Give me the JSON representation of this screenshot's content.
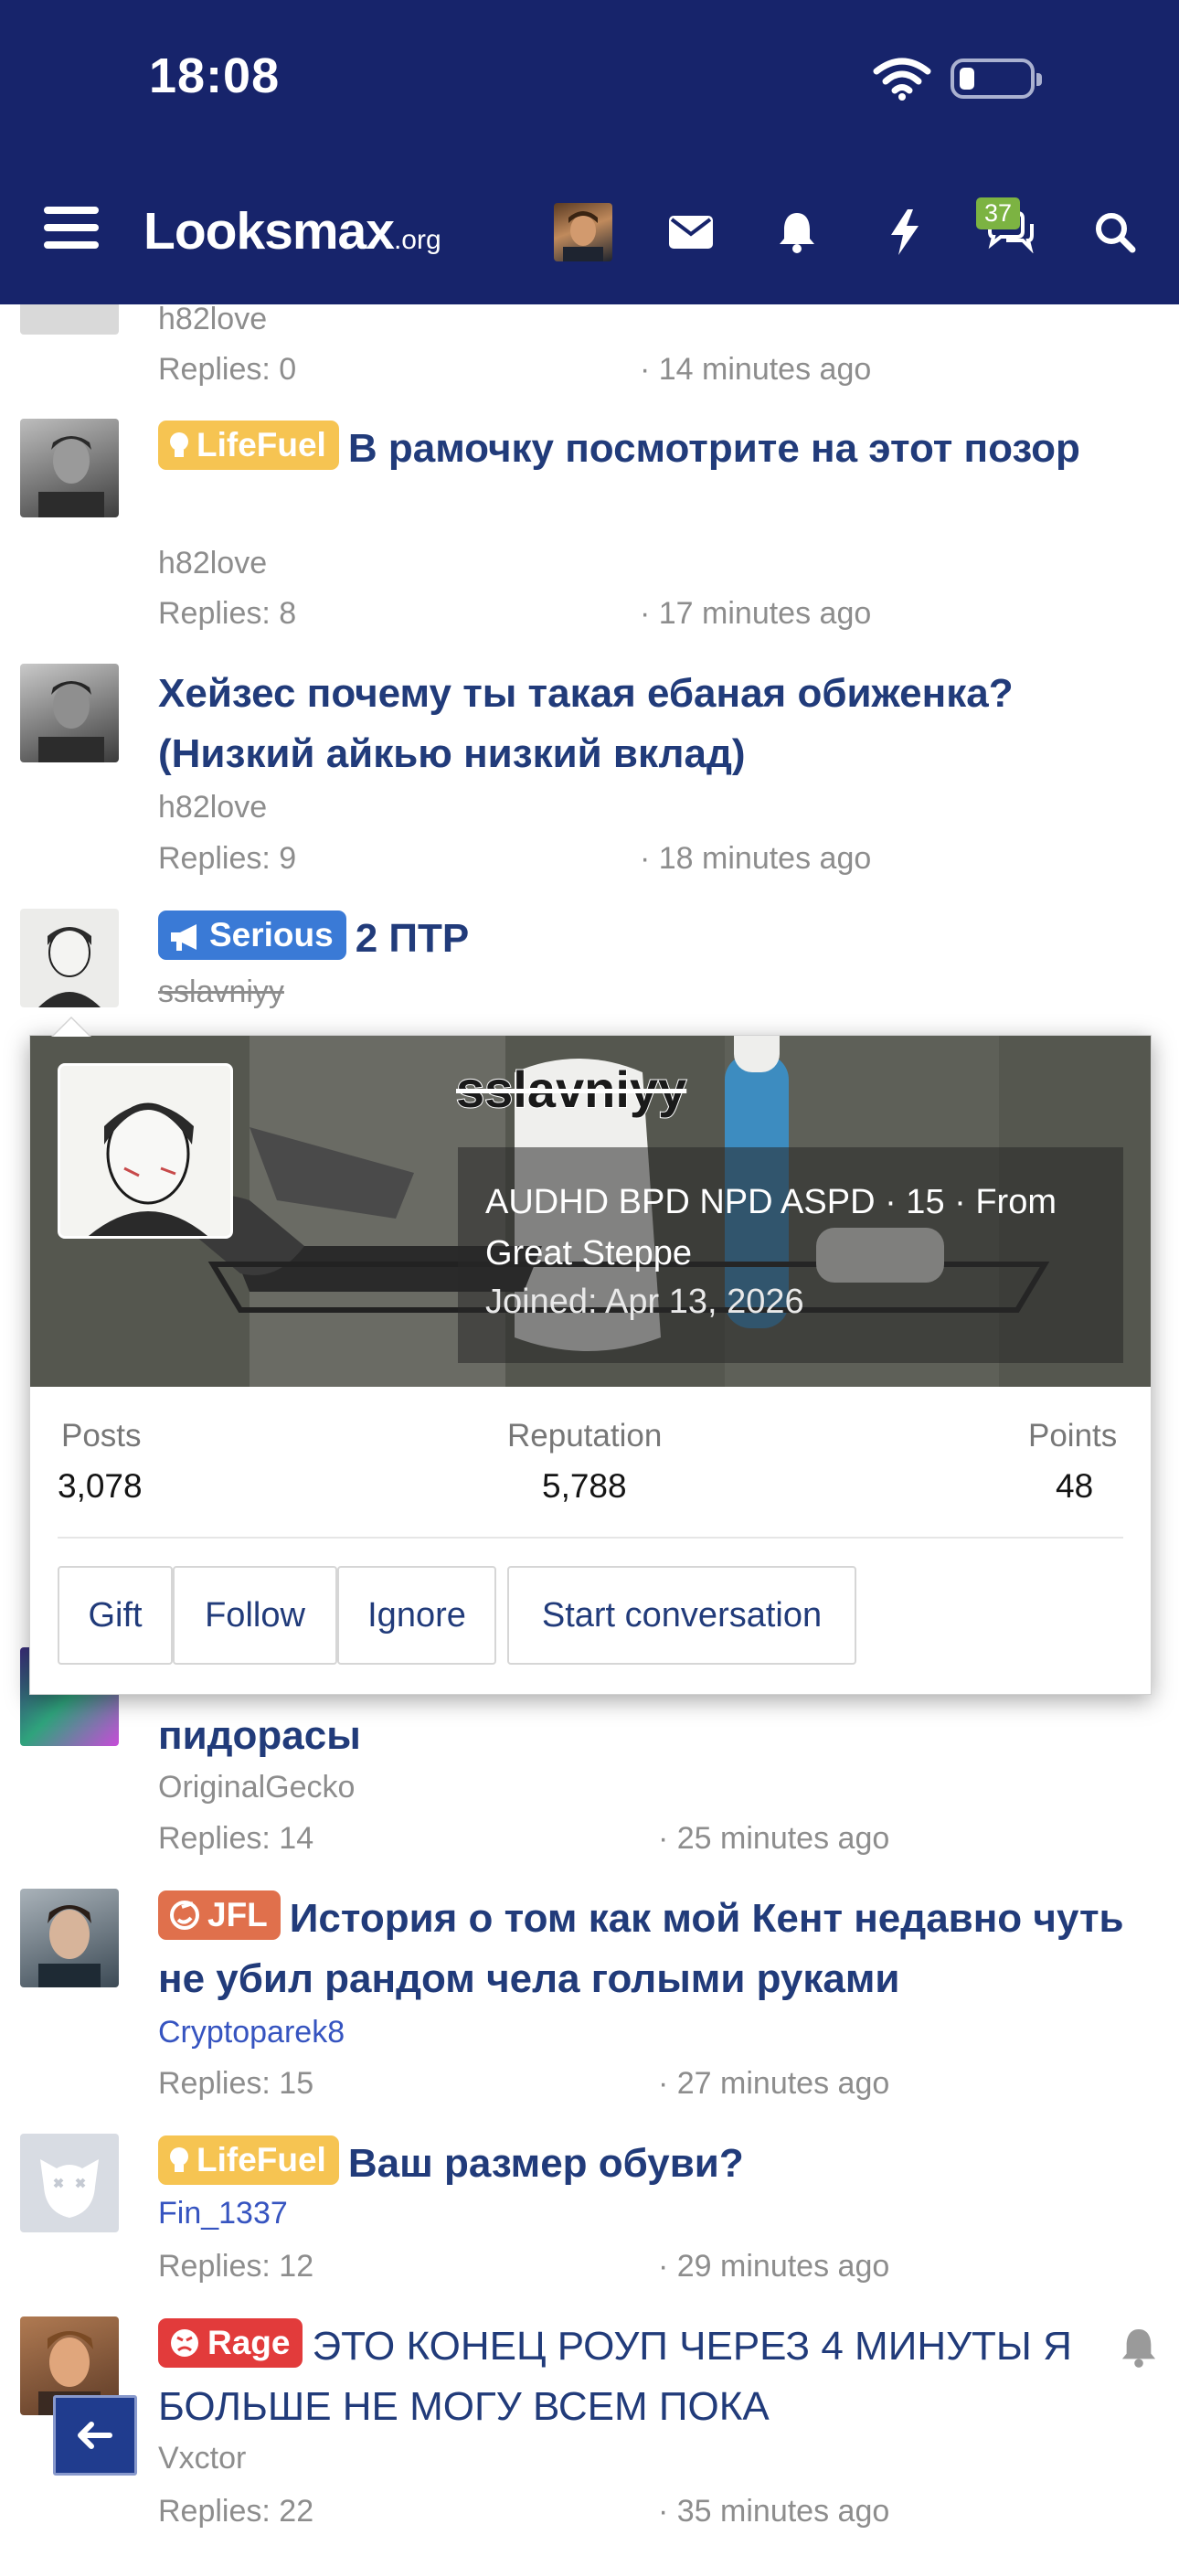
{
  "status": {
    "time": "18:08"
  },
  "header": {
    "logo_main": "Looksmax",
    "logo_suffix": ".org",
    "messages_badge": "37"
  },
  "threads": [
    {
      "title": "",
      "author": "h82love",
      "replies": "Replies: 0",
      "time": "· 14 minutes ago"
    },
    {
      "prefix": "LifeFuel",
      "title": "В рамочку посмотрите на этот позор",
      "author": "h82love",
      "replies": "Replies: 8",
      "time": "· 17 minutes ago"
    },
    {
      "title": "Хейзес почему ты такая ебаная обиженка? (Низкий айкью низкий вклад)",
      "author": "h82love",
      "replies": "Replies: 9",
      "time": "· 18 minutes ago"
    },
    {
      "prefix": "Serious",
      "title": "2 ПТР",
      "author": "sslavniyy"
    },
    {
      "title": "пидорасы",
      "author": "OriginalGecko",
      "replies": "Replies: 14",
      "time": "· 25 minutes ago"
    },
    {
      "prefix": "JFL",
      "title": "История о том как мой Кент недавно чуть не убил рандом чела голыми руками",
      "author": "Cryptoparek8",
      "replies": "Replies: 15",
      "time": "· 27 minutes ago"
    },
    {
      "prefix": "LifeFuel",
      "title": "Ваш размер обуви?",
      "author": "Fin_1337",
      "replies": "Replies: 12",
      "time": "· 29 minutes ago"
    },
    {
      "prefix": "Rage",
      "title": "ЭТО КОНЕЦ РОУП ЧЕРЕЗ 4 МИНУТЫ Я БОЛЬШЕ НЕ МОГУ ВСЕМ ПОКА",
      "author": "Vxctor",
      "replies": "Replies: 22",
      "time": "· 35 minutes ago"
    }
  ],
  "popup": {
    "name": "sslavniyy",
    "blurb": "AUDHD BPD NPD ASPD · 15 · From Great Steppe",
    "joined_label": "Joined:",
    "joined_date": "Apr 13, 2026",
    "stats": [
      {
        "label": "Posts",
        "value": "3,078"
      },
      {
        "label": "Reputation",
        "value": "5,788"
      },
      {
        "label": "Points",
        "value": "48"
      }
    ],
    "buttons": {
      "gift": "Gift",
      "follow": "Follow",
      "ignore": "Ignore",
      "start_conversation": "Start conversation"
    }
  },
  "colors": {
    "header_bg": "#17246b",
    "link": "#213b7a",
    "lifefuel": "#f6c452",
    "serious": "#3a7ad6",
    "jfl": "#e0704c",
    "rage": "#e23b3b",
    "badge": "#7cb342"
  },
  "icons": [
    "hamburger-icon",
    "mail-icon",
    "bell-icon",
    "bolt-icon",
    "chat-icon",
    "search-icon",
    "wifi-icon",
    "battery-icon",
    "bulb-icon",
    "megaphone-icon",
    "jfl-icon",
    "rage-icon",
    "back-arrow-icon"
  ]
}
